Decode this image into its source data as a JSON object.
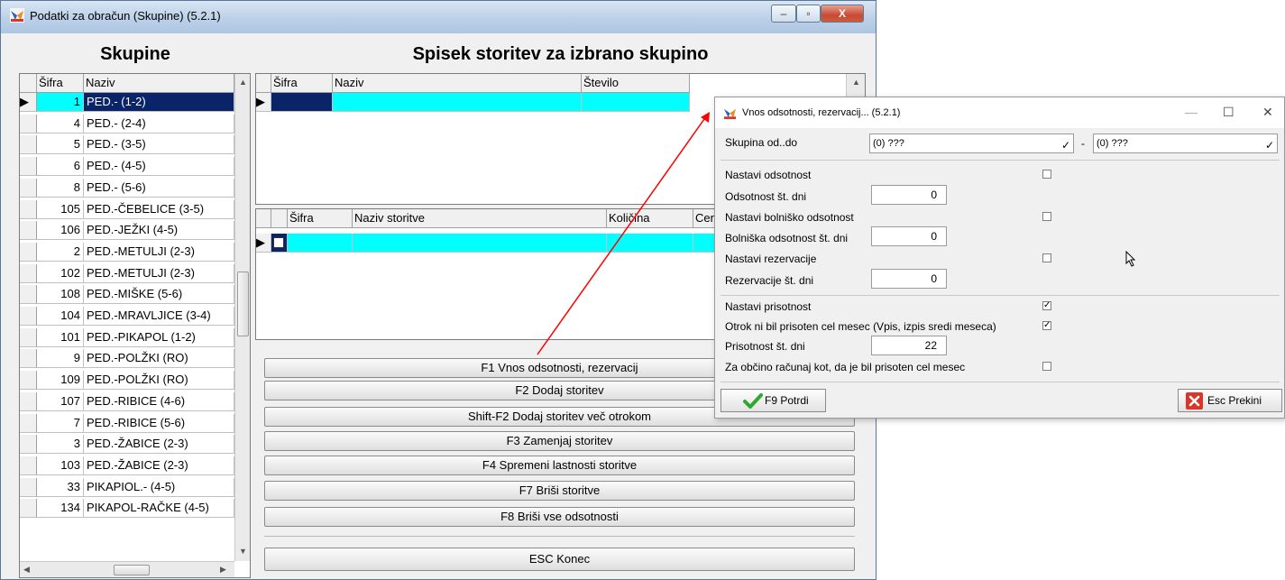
{
  "main_window": {
    "title": "Podatki za obračun (Skupine)  (5.2.1)",
    "controls": {
      "minimize": "–",
      "maximize": "▫",
      "close": "X"
    }
  },
  "left_panel": {
    "heading": "Skupine",
    "columns": {
      "sifra": "Šifra",
      "naziv": "Naziv"
    },
    "rows": [
      {
        "sifra": "1",
        "naziv": "PED.- (1-2)"
      },
      {
        "sifra": "4",
        "naziv": "PED.- (2-4)"
      },
      {
        "sifra": "5",
        "naziv": "PED.- (3-5)"
      },
      {
        "sifra": "6",
        "naziv": "PED.- (4-5)"
      },
      {
        "sifra": "8",
        "naziv": "PED.- (5-6)"
      },
      {
        "sifra": "105",
        "naziv": "PED.-ČEBELICE (3-5)"
      },
      {
        "sifra": "106",
        "naziv": "PED.-JEŽKI (4-5)"
      },
      {
        "sifra": "2",
        "naziv": "PED.-METULJI (2-3)"
      },
      {
        "sifra": "102",
        "naziv": "PED.-METULJI (2-3)"
      },
      {
        "sifra": "108",
        "naziv": "PED.-MIŠKE (5-6)"
      },
      {
        "sifra": "104",
        "naziv": "PED.-MRAVLJICE (3-4)"
      },
      {
        "sifra": "101",
        "naziv": "PED.-PIKAPOL (1-2)"
      },
      {
        "sifra": "9",
        "naziv": "PED.-POLŽKI (RO)"
      },
      {
        "sifra": "109",
        "naziv": "PED.-POLŽKI (RO)"
      },
      {
        "sifra": "107",
        "naziv": "PED.-RIBICE (4-6)"
      },
      {
        "sifra": "7",
        "naziv": "PED.-RIBICE (5-6)"
      },
      {
        "sifra": "3",
        "naziv": "PED.-ŽABICE (2-3)"
      },
      {
        "sifra": "103",
        "naziv": "PED.-ŽABICE (2-3)"
      },
      {
        "sifra": "33",
        "naziv": "PIKAPIOL.- (4-5)"
      },
      {
        "sifra": "134",
        "naziv": "PIKAPOL-RAČKE (4-5)"
      }
    ]
  },
  "right_panel": {
    "heading": "Spisek storitev za izbrano skupino",
    "top_grid_columns": {
      "sifra": "Šifra",
      "naziv": "Naziv",
      "stevilo": "Število"
    },
    "bottom_grid_columns": {
      "sifra": "Šifra",
      "naziv_storitve": "Naziv storitve",
      "kolicina": "Količina",
      "cena": "Cen"
    },
    "buttons": {
      "f1": "F1 Vnos odsotnosti, rezervacij",
      "f2": "F2 Dodaj storitev",
      "shift_f2": "Shift-F2 Dodaj storitev več otrokom",
      "f3": "F3 Zamenjaj storitev",
      "f4": "F4 Spremeni lastnosti storitve",
      "f7": "F7 Briši storitve",
      "f8": "F8 Briši vse odsotnosti",
      "esc": "ESC Konec"
    }
  },
  "dialog": {
    "title": "Vnos odsotnosti, rezervacij...  (5.2.1)",
    "controls": {
      "minimize": "—",
      "maximize": "☐",
      "close": "✕"
    },
    "skupina_label": "Skupina od..do",
    "skupina_from": "(0) ???",
    "skupina_to": "(0) ???",
    "dash": "-",
    "dropdown_glyph": "✓",
    "fields": {
      "nastavi_odsotnost": {
        "label": "Nastavi odsotnost",
        "checked": false
      },
      "odsotnost_dni": {
        "label": "Odsotnost št. dni",
        "value": "0"
      },
      "nastavi_bolnisko": {
        "label": "Nastavi bolniško odsotnost",
        "checked": false
      },
      "bolniska_dni": {
        "label": "Bolniška odsotnost št. dni",
        "value": "0"
      },
      "nastavi_rezervacije": {
        "label": "Nastavi rezervacije",
        "checked": false
      },
      "rezervacije_dni": {
        "label": "Rezervacije št. dni",
        "value": "0"
      },
      "nastavi_prisotnost": {
        "label": "Nastavi prisotnost",
        "checked": true
      },
      "otrok_ni_bil": {
        "label": "Otrok ni bil prisoten cel mesec (Vpis,  izpis sredi meseca)",
        "checked": true
      },
      "prisotnost_dni": {
        "label": "Prisotnost št. dni",
        "value": "22"
      },
      "za_obcino": {
        "label": "Za občino računaj kot, da je bil prisoten cel mesec",
        "checked": false
      }
    },
    "buttons": {
      "confirm": "F9 Potrdi",
      "cancel": "Esc Prekini"
    }
  },
  "colors": {
    "selected_row": "#0a246a",
    "cyan_cell": "#00ffff",
    "arrow": "#ff0000",
    "confirm_check": "#2fa82f",
    "cancel_x": "#d9352a"
  }
}
